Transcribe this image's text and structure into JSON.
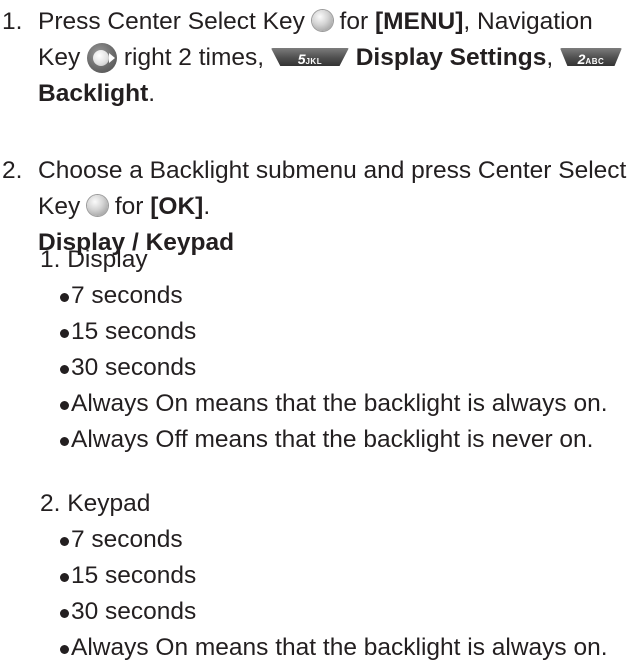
{
  "steps": [
    {
      "number": "1.",
      "text_1": "Press Center Select Key",
      "text_2": "for",
      "menu_label": "[MENU]",
      "text_3": ", Navigation",
      "text_4": "Key",
      "text_5": "right 2 times,",
      "key_5": {
        "digit": "5",
        "sub": "JKL"
      },
      "display_settings": "Display Settings",
      "comma": ",",
      "key_2": {
        "digit": "2",
        "sub": "ABC"
      },
      "backlight": "Backlight",
      "period": "."
    },
    {
      "number": "2.",
      "text_1": "Choose a Backlight submenu and press Center Select",
      "text_2": "Key",
      "text_3": "for",
      "ok_label": "[OK]",
      "period": ".",
      "heading": "Display / Keypad"
    }
  ],
  "submenus": [
    {
      "title": "1. Display",
      "options": [
        "7 seconds",
        "15 seconds",
        "30 seconds",
        "Always On means that the backlight is always on.",
        "Always Off means that the backlight is never on."
      ]
    },
    {
      "title": "2. Keypad",
      "options": [
        "7 seconds",
        "15 seconds",
        "30 seconds",
        "Always On means that the backlight is always on."
      ]
    }
  ],
  "icons": {
    "center_key": "center-select-key-icon",
    "navigation_key": "navigation-key-right-icon",
    "key_5": "number-key-5-icon",
    "key_2": "number-key-2-icon"
  },
  "colors": {
    "text": "#231f20",
    "key_dark": "#4f4f4f",
    "key_light": "#d4d4d4"
  }
}
